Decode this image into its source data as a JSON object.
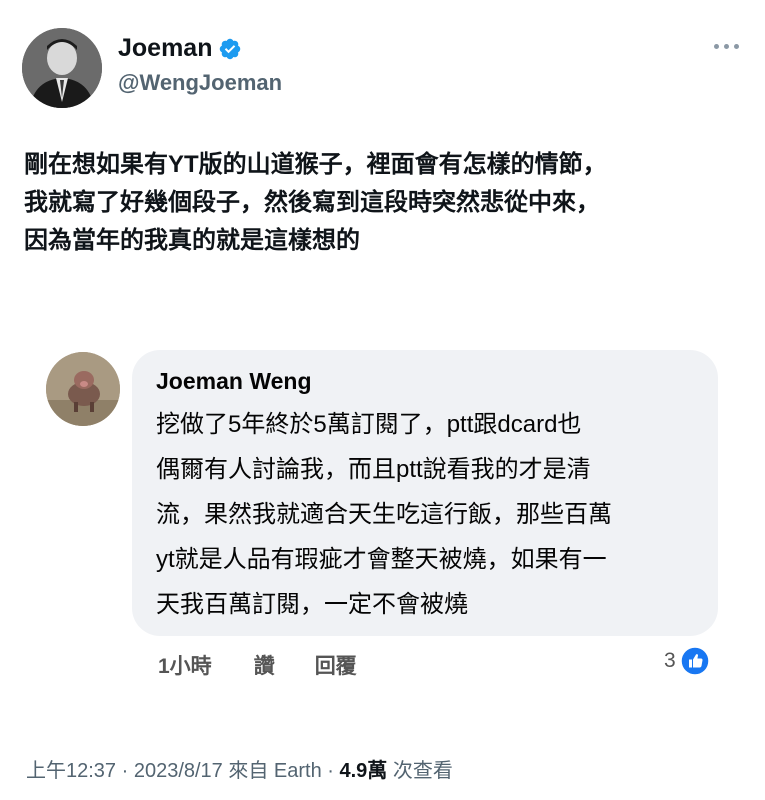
{
  "author": {
    "display_name": "Joeman",
    "handle": "@WengJoeman",
    "icons": {
      "verified": "verified-badge-icon",
      "more": "more-options-icon"
    },
    "colors": {
      "verified": "#1d9bf0"
    }
  },
  "tweet": {
    "lines": [
      "剛在想如果有YT版的山道猴子，裡面會有怎樣的情節，",
      "我就寫了好幾個段子，然後寫到這段時突然悲從中來，",
      "因為當年的我真的就是這樣想的"
    ]
  },
  "embedded_comment": {
    "commenter_name": "Joeman Weng",
    "body_lines": [
      "挖做了5年終於5萬訂閱了，ptt跟dcard也",
      "偶爾有人討論我，而且ptt說看我的才是清",
      "流，果然我就適合天生吃這行飯，那些百萬",
      "yt就是人品有瑕疵才會整天被燒，如果有一",
      "天我百萬訂閱，一定不會被燒"
    ],
    "actions": {
      "time": "1小時",
      "like": "讚",
      "reply": "回覆"
    },
    "reaction_count": "3",
    "colors": {
      "bubble": "#f0f2f5",
      "like_icon": "#1877f2"
    }
  },
  "meta": {
    "prefix": "上午12:37 · 2023/8/17 來自 Earth · ",
    "views_count": "4.9萬",
    "views_suffix": " 次查看"
  }
}
